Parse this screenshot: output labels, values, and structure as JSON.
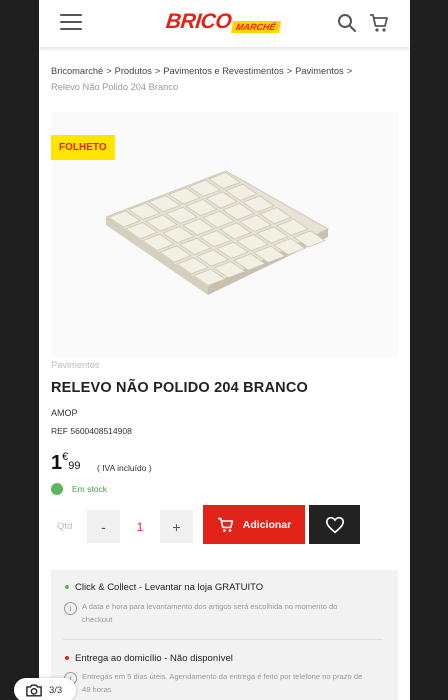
{
  "header": {
    "logo_text": "BRICO",
    "logo_sub": "MARCHÉ",
    "icons": [
      "menu-icon",
      "search-icon",
      "cart-icon"
    ]
  },
  "breadcrumb": {
    "items": [
      "Bricomarché",
      "Produtos",
      "Pavimentos e Revestimentos",
      "Pavimentos"
    ],
    "current": "Relevo Não Polido 204 Branco",
    "separator": ">"
  },
  "product": {
    "badge": "FOLHETO",
    "category": "Pavimentos",
    "title": "RELEVO NÃO POLIDO 204 BRANCO",
    "brand": "AMOP",
    "ref": "REF 5600408514908",
    "price_int": "1",
    "price_currency": "€",
    "price_cents": "99",
    "iva": "( IVA incluído )",
    "stock": "Em stock",
    "stock_color": "#5cb85c"
  },
  "purchase": {
    "qty_label": "Qtd",
    "qty_minus": "-",
    "qty_value": "1",
    "qty_plus": "+",
    "add_label": "Adicionar",
    "accent": "#e2231a"
  },
  "delivery": {
    "click_collect": {
      "title": "Click & Collect - Levantar na loja GRATUITO",
      "desc": "A data e hora para levantamento dos artigos será escolhida no momento do checkout",
      "dot_color": "#5cb85c"
    },
    "home": {
      "title": "Entrega ao domicílio - Não disponível",
      "desc": "Entregas em 5 dias úteis. Agendamento da entrega é feito por telefone no prazo de 48 horas",
      "dot_color": "#e2231a"
    }
  },
  "gallery_counter": "3/3"
}
